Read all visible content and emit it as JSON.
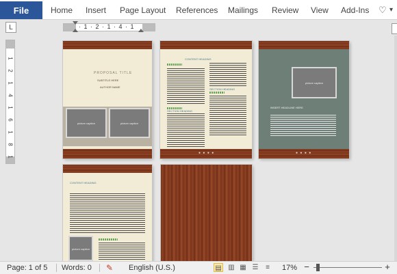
{
  "ribbon": {
    "file_label": "File",
    "tabs": [
      "Home",
      "Insert",
      "Page Layout",
      "References",
      "Mailings",
      "Review",
      "View",
      "Add-Ins"
    ],
    "right_icon": "heart-icon"
  },
  "ruler": {
    "corner_glyph": "L",
    "horizontal_ticks": "· 1 · 2 · 1 · 4 · 1",
    "vertical_numbers": [
      "1",
      "2",
      "1",
      "4",
      "1",
      "6",
      "1",
      "8",
      "1"
    ]
  },
  "pages": {
    "cover": {
      "title": "PROPOSAL TITLE",
      "subtitle": "SUBTITLE HERE",
      "author": "AUTHOR NAME",
      "caption1": "picture caption",
      "caption2": "picture caption"
    },
    "content": {
      "heading1": "CONTENT HEADING",
      "heading2": "SECTION HEADING",
      "heading3": "SECTION HEADING"
    },
    "summary": {
      "caption": "picture caption",
      "heading": "INSERT HEADLINE HERE"
    },
    "page4": {
      "heading": "CONTENT HEADING",
      "caption": "picture caption"
    }
  },
  "status": {
    "page_info": "Page: 1 of 5",
    "words": "Words: 0",
    "language": "English (U.S.)",
    "zoom": "17%",
    "zoom_out": "−",
    "zoom_in": "+"
  }
}
